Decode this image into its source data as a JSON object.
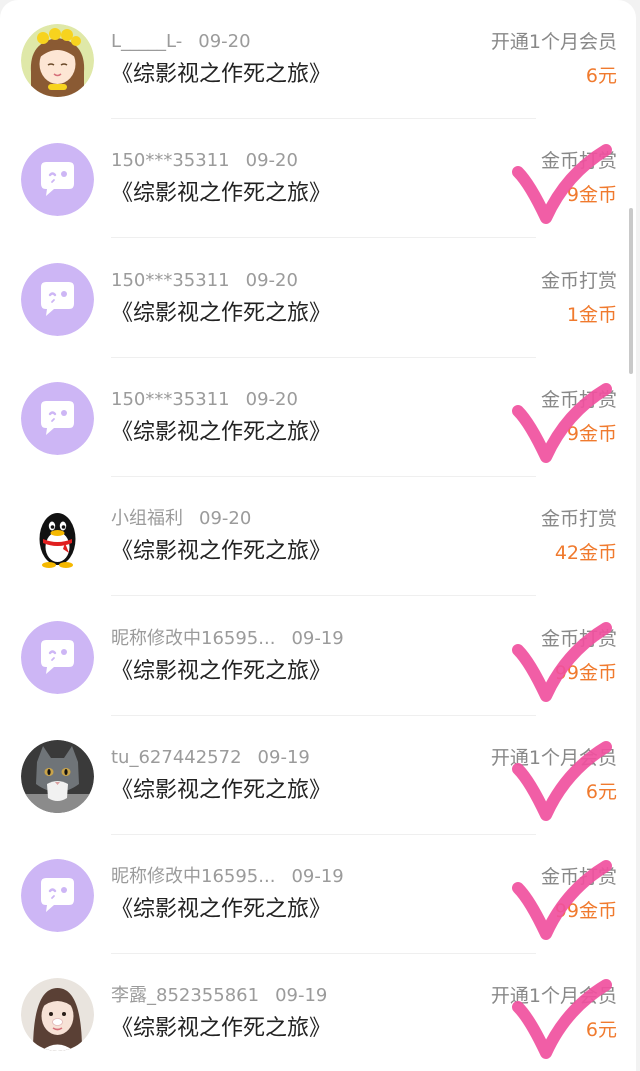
{
  "book_title": "《综影视之作死之旅》",
  "colors": {
    "amount_orange": "#f07a2e",
    "avatar_purple": "#cdb6f5",
    "check_pink": "#f0509e",
    "meta_gray": "#9b9b9b"
  },
  "records": [
    {
      "user": "L_____L-",
      "date": "09-20",
      "action": "开通1个月会员",
      "amount": "6元",
      "title": "《综影视之作死之旅》",
      "avatar": "cartoon-girl"
    },
    {
      "user": "150***35311",
      "date": "09-20",
      "action": "金币打赏",
      "amount": "9金币",
      "title": "《综影视之作死之旅》",
      "avatar": "default-chat"
    },
    {
      "user": "150***35311",
      "date": "09-20",
      "action": "金币打赏",
      "amount": "1金币",
      "title": "《综影视之作死之旅》",
      "avatar": "default-chat"
    },
    {
      "user": "150***35311",
      "date": "09-20",
      "action": "金币打赏",
      "amount": "9金币",
      "title": "《综影视之作死之旅》",
      "avatar": "default-chat"
    },
    {
      "user": "小组福利",
      "date": "09-20",
      "action": "金币打赏",
      "amount": "42金币",
      "title": "《综影视之作死之旅》",
      "avatar": "penguin"
    },
    {
      "user": "昵称修改中16595...",
      "date": "09-19",
      "action": "金币打赏",
      "amount": "99金币",
      "title": "《综影视之作死之旅》",
      "avatar": "default-chat"
    },
    {
      "user": "tu_627442572",
      "date": "09-19",
      "action": "开通1个月会员",
      "amount": "6元",
      "title": "《综影视之作死之旅》",
      "avatar": "cat-photo"
    },
    {
      "user": "昵称修改中16595...",
      "date": "09-19",
      "action": "金币打赏",
      "amount": "99金币",
      "title": "《综影视之作死之旅》",
      "avatar": "default-chat"
    },
    {
      "user": "李露_852355861",
      "date": "09-19",
      "action": "开通1个月会员",
      "amount": "6元",
      "title": "《综影视之作死之旅》",
      "avatar": "girl-photo"
    }
  ],
  "check_marks": [
    {
      "row": 1,
      "icon": "check-mark"
    },
    {
      "row": 3,
      "icon": "check-mark"
    },
    {
      "row": 5,
      "icon": "check-mark"
    },
    {
      "row": 6,
      "icon": "check-mark"
    },
    {
      "row": 7,
      "icon": "check-mark"
    },
    {
      "row": 8,
      "icon": "check-mark"
    }
  ]
}
